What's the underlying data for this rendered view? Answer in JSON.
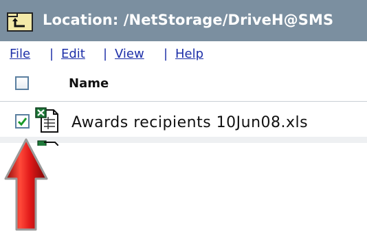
{
  "window": {
    "title": "Location: /NetStorage/DriveH@SMS"
  },
  "menu": {
    "items": [
      {
        "label": "File"
      },
      {
        "label": "Edit"
      },
      {
        "label": "View"
      },
      {
        "label": "Help"
      }
    ],
    "separator": "|"
  },
  "table": {
    "header_name": "Name",
    "header_checked": false,
    "rows": [
      {
        "name": "Awards recipients 10Jun08.xls",
        "checked": true,
        "icon": "spreadsheet-file-icon"
      }
    ]
  },
  "annotation": {
    "icon": "red-up-arrow-icon",
    "color": "#d41414"
  },
  "colors": {
    "title_bar": "#7b8fa0",
    "link": "#1d2fa8"
  }
}
